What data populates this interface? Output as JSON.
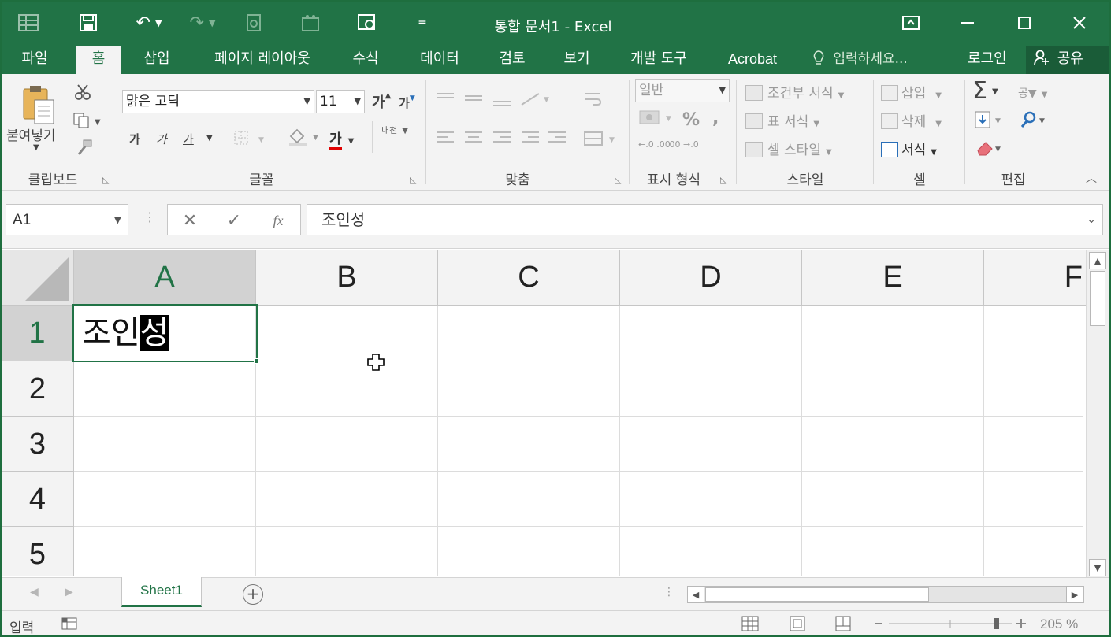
{
  "title_bar": {
    "title": "통합 문서1 - Excel",
    "quick_access": [
      "save-icon",
      "undo-icon",
      "redo-icon",
      "print-preview-icon",
      "form-icon",
      "touch-mode-icon",
      "customize-icon"
    ]
  },
  "tabs": [
    "파일",
    "홈",
    "삽입",
    "페이지 레이아웃",
    "수식",
    "데이터",
    "검토",
    "보기",
    "개발 도구",
    "Acrobat"
  ],
  "active_tab": "홈",
  "tell_me": "입력하세요...",
  "login": "로그인",
  "share": "공유",
  "ribbon": {
    "clipboard": {
      "paste": "붙여넣기",
      "label": "클립보드"
    },
    "font": {
      "name": "맑은 고딕",
      "size": "11",
      "grow": "가",
      "shrink": "가",
      "bold": "가",
      "italic": "가",
      "underline": "가",
      "color_letter": "가",
      "phonetic": "내천",
      "label": "글꼴",
      "font_color": "#e00000"
    },
    "alignment": {
      "label": "맞춤"
    },
    "number": {
      "format": "일반",
      "percent": "%",
      "comma": ",",
      "inc_dec": "←.0 .00",
      "dec_dec": ".00 →.0",
      "label": "표시 형식"
    },
    "styles": {
      "conditional": "조건부 서식",
      "table": "표 서식",
      "cell": "셀 스타일",
      "label": "스타일"
    },
    "cells": {
      "insert": "삽입",
      "delete": "삭제",
      "format": "서식",
      "label": "셀"
    },
    "editing": {
      "sum": "Σ",
      "sort": "공▼",
      "label": "편집"
    }
  },
  "formula_bar": {
    "name_box": "A1",
    "cancel": "✕",
    "enter": "✓",
    "fx": "fx",
    "content": "조인성"
  },
  "grid": {
    "columns": [
      "A",
      "B",
      "C",
      "D",
      "E",
      "F"
    ],
    "rows": [
      "1",
      "2",
      "3",
      "4",
      "5"
    ],
    "active_cell": {
      "ref": "A1",
      "committed_text": "조인",
      "composing_text": "성"
    }
  },
  "sheets": {
    "tabs": [
      "Sheet1"
    ],
    "active": "Sheet1"
  },
  "status_bar": {
    "mode": "입력",
    "zoom": "205 %"
  },
  "colors": {
    "accent": "#217346",
    "ribbon_bg": "#f3f3f3",
    "selection_header": "#d2d2d2"
  }
}
